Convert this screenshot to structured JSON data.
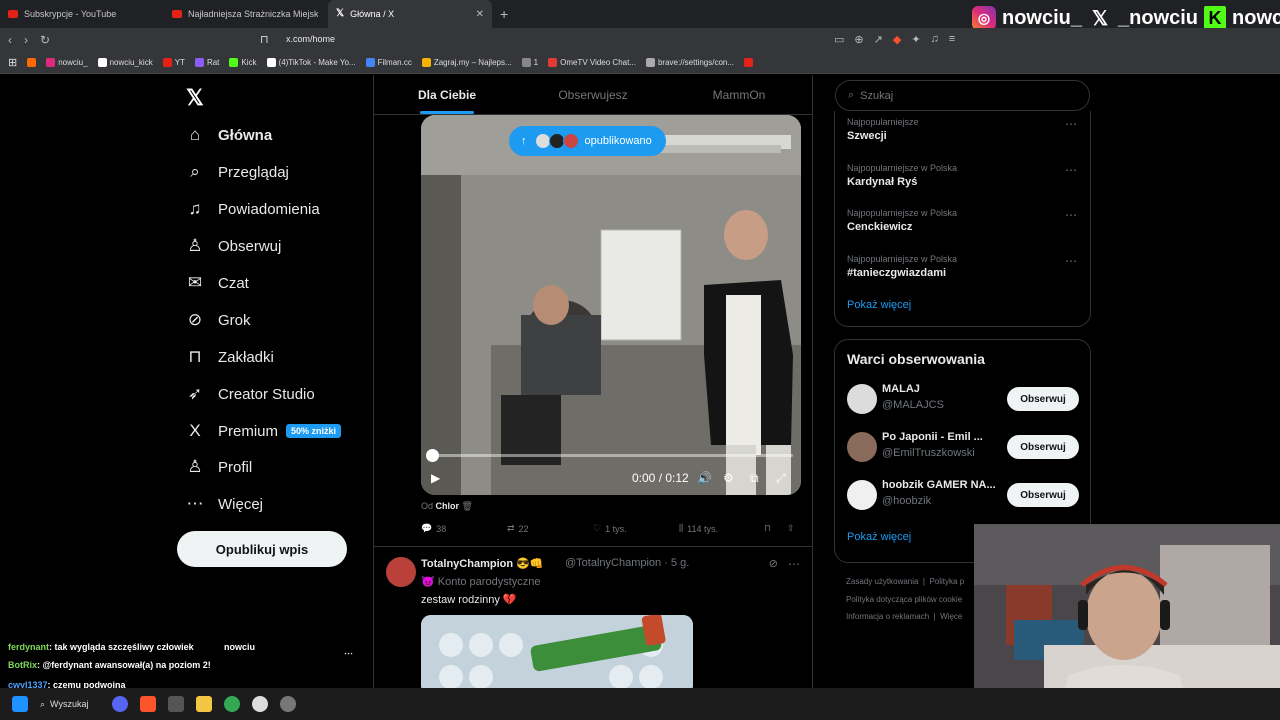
{
  "tabs": [
    {
      "title": "Subskrypcje - YouTube",
      "icon": "youtube-icon"
    },
    {
      "title": "Najładniejsza Strażniczka Miejska w P",
      "icon": "youtube-icon"
    },
    {
      "title": "Główna / X",
      "icon": "x-icon"
    }
  ],
  "overlay": {
    "instagram": "nowciu_",
    "x": "_nowciu",
    "kick": "nowciu"
  },
  "address": {
    "url": "x.com/home"
  },
  "bookmarks": [
    {
      "label": "",
      "color": "#ff6a00"
    },
    {
      "label": "nowciu_",
      "color": "#dd2a7b"
    },
    {
      "label": "nowciu_kick",
      "color": "#ffffff"
    },
    {
      "label": "YT",
      "color": "#e62117"
    },
    {
      "label": "Rat",
      "color": "#8b5cf6"
    },
    {
      "label": "Kick",
      "color": "#53fc18"
    },
    {
      "label": "(4)TikTok - Make Yo...",
      "color": "#ffffff"
    },
    {
      "label": "Filman.cc",
      "color": "#4285f4"
    },
    {
      "label": "Zagraj.my – Najleps...",
      "color": "#f4b400"
    },
    {
      "label": "1",
      "color": "#888888"
    },
    {
      "label": "OmeTV Video Chat...",
      "color": "#e53935"
    },
    {
      "label": "brave://settings/con...",
      "color": "#aaaaaa"
    },
    {
      "label": "",
      "color": "#e62117"
    }
  ],
  "nav": {
    "items": [
      {
        "label": "Główna",
        "icon": "home-icon",
        "glyph": "⌂"
      },
      {
        "label": "Przeglądaj",
        "icon": "search-icon",
        "glyph": "⌕"
      },
      {
        "label": "Powiadomienia",
        "icon": "bell-icon",
        "glyph": "♫"
      },
      {
        "label": "Obserwuj",
        "icon": "add-user-icon",
        "glyph": "♙"
      },
      {
        "label": "Czat",
        "icon": "mail-icon",
        "glyph": "✉"
      },
      {
        "label": "Grok",
        "icon": "grok-icon",
        "glyph": "⊘"
      },
      {
        "label": "Zakładki",
        "icon": "bookmark-icon",
        "glyph": "⊓"
      },
      {
        "label": "Creator Studio",
        "icon": "rocket-icon",
        "glyph": "➶"
      },
      {
        "label": "Premium",
        "icon": "x-premium-icon",
        "glyph": "X"
      },
      {
        "label": "Profil",
        "icon": "person-icon",
        "glyph": "♙"
      },
      {
        "label": "Więcej",
        "icon": "more-icon",
        "glyph": "⋯"
      }
    ],
    "premium_badge": "50% zniżki",
    "post_button": "Opublikuj wpis"
  },
  "feed": {
    "tabs": [
      "Dla Ciebie",
      "Obserwujesz",
      "MammOn"
    ],
    "published_pill": "opublikowano",
    "video": {
      "time": "0:00 / 0:12",
      "progress": 0
    },
    "from_label": "Od",
    "from_name": "Chlor",
    "actions": {
      "replies": "38",
      "reposts": "22",
      "likes": "1 tys.",
      "views": "114 tys."
    },
    "tweet2": {
      "name": "TotalnyChampion 😎👊",
      "handle": "@TotalnyChampion · 5 g.",
      "sub": "😈 Konto parodystyczne",
      "text": "zestaw rodzinny 💔"
    }
  },
  "sidebar": {
    "search_placeholder": "Szukaj",
    "trends": [
      {
        "meta": "Najpopularniejsze",
        "name": "Szwecji"
      },
      {
        "meta": "Najpopularniejsze w Polska",
        "name": "Kardynał Ryś"
      },
      {
        "meta": "Najpopularniejsze w Polska",
        "name": "Cenckiewicz"
      },
      {
        "meta": "Najpopularniejsze w Polska",
        "name": "#tanieczgwiazdami"
      }
    ],
    "show_more": "Pokaż więcej",
    "follow_title": "Warci obserwowania",
    "follow": [
      {
        "name": "MALAJ",
        "handle": "@MALAJCS"
      },
      {
        "name": "Po Japonii - Emil ...",
        "handle": "@EmilTruszkowski"
      },
      {
        "name": "hoobzik GAMER NA...",
        "handle": "@hoobzik"
      }
    ],
    "follow_button": "Obserwuj",
    "footer": [
      "Zasady użytkowania",
      "Polityka p",
      "Polityka dotycząca plików cookie",
      "Informacja o reklamach",
      "Więce"
    ]
  },
  "chat": [
    {
      "user": "ferdynant",
      "text": ": tak wygląda szczęśliwy człowiek",
      "color": "#7fd858"
    },
    {
      "user": "BotRix",
      "text": ": @ferdynant awansował(a) na poziom 2!",
      "color": "#7fd858"
    },
    {
      "user": "cwyl1337",
      "text": ": czemu podwojna",
      "color": "#4fa3ff"
    }
  ],
  "chat_overlay_name": "nowciu",
  "taskbar": {
    "search": "Wyszukaj"
  }
}
